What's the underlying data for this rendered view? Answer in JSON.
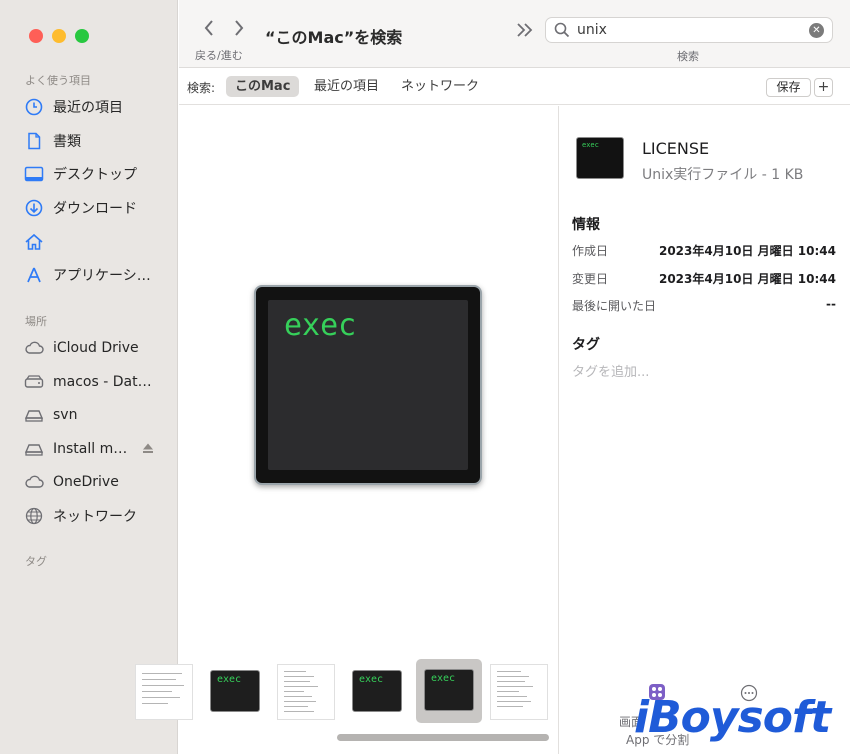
{
  "window": {
    "title": "“このMac”を検索",
    "nav_label": "戻る/進む",
    "search_value": "unix",
    "search_caption": "検索"
  },
  "sidebar": {
    "favorites_header": "よく使う項目",
    "favorites": [
      {
        "label": "最近の項目",
        "icon": "clock-icon"
      },
      {
        "label": "書類",
        "icon": "document-icon"
      },
      {
        "label": "デスクトップ",
        "icon": "desktop-icon"
      },
      {
        "label": "ダウンロード",
        "icon": "download-icon"
      },
      {
        "label": "",
        "icon": "home-icon"
      },
      {
        "label": "アプリケーシ…",
        "icon": "applications-icon"
      }
    ],
    "locations_header": "場所",
    "locations": [
      {
        "label": "iCloud Drive",
        "icon": "cloud-icon"
      },
      {
        "label": "macos - Dat…",
        "icon": "disk-icon"
      },
      {
        "label": "svn",
        "icon": "drive-icon"
      },
      {
        "label": "Install m…",
        "icon": "drive-icon"
      },
      {
        "label": "OneDrive",
        "icon": "cloud-icon"
      },
      {
        "label": "ネットワーク",
        "icon": "network-icon"
      }
    ],
    "tags_header": "タグ"
  },
  "scopebar": {
    "label": "検索:",
    "scopes": [
      "このMac",
      "最近の項目",
      "ネットワーク"
    ],
    "active_scope": "このMac",
    "save_label": "保存",
    "add_label": "+"
  },
  "preview": {
    "icon_text": "exec",
    "thumb_text": "exec"
  },
  "inspector": {
    "file_name": "LICENSE",
    "file_kind": "Unix実行ファイル - 1 KB",
    "icon_text": "exec",
    "info_header": "情報",
    "rows": [
      {
        "label": "作成日",
        "value": "2023年4月10日 月曜日 10:44"
      },
      {
        "label": "変更日",
        "value": "2023年4月10日 月曜日 10:44"
      },
      {
        "label": "最後に開いた日",
        "value": "--"
      }
    ],
    "tags_header": "タグ",
    "tags_placeholder": "タグを追加..."
  },
  "overlay": {
    "caption_1": "画面",
    "caption_2": "App で分割"
  },
  "colors": {
    "exec_green": "#36d05a",
    "sidebar_bg": "#e9e6e3",
    "accent": "#2f7bf6"
  }
}
